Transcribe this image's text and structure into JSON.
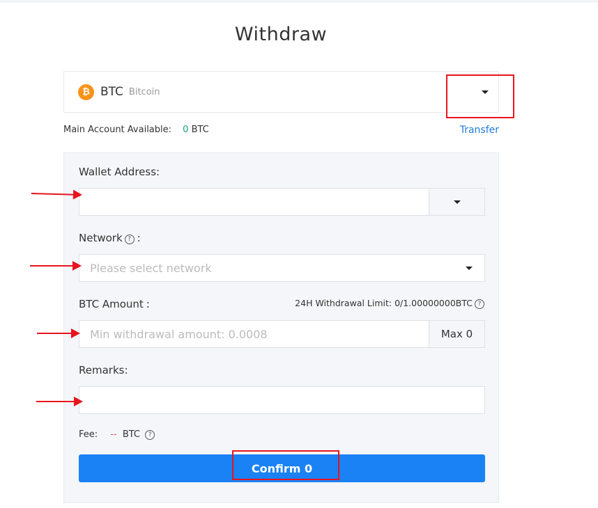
{
  "page": {
    "title": "Withdraw"
  },
  "coin": {
    "icon_glyph": "₿",
    "icon_color": "#f7931a",
    "symbol": "BTC",
    "name": "Bitcoin"
  },
  "account": {
    "label": "Main Account Available:",
    "amount": "0",
    "unit": "BTC",
    "transfer_label": "Transfer"
  },
  "form": {
    "wallet_address": {
      "label": "Wallet Address",
      "colon": ":",
      "value": ""
    },
    "network": {
      "label": "Network",
      "colon": ":",
      "placeholder": "Please  select  network"
    },
    "amount": {
      "label": "BTC Amount",
      "colon": ":",
      "placeholder": "Min withdrawal amount:  0.0008",
      "max_label": "Max 0",
      "limit_text": "24H Withdrawal Limit: 0/1.00000000BTC"
    },
    "remarks": {
      "label": "Remarks",
      "colon": ":",
      "value": ""
    },
    "fee": {
      "label": "Fee:",
      "value": "--",
      "unit": "BTC"
    },
    "confirm_label": "Confirm 0"
  },
  "icons": {
    "help": "?"
  },
  "colors": {
    "accent": "#1a82f5",
    "link": "#1e7bdc",
    "available_value": "#16a085",
    "fee_value": "#e05656",
    "annotation": "#e8141c"
  }
}
